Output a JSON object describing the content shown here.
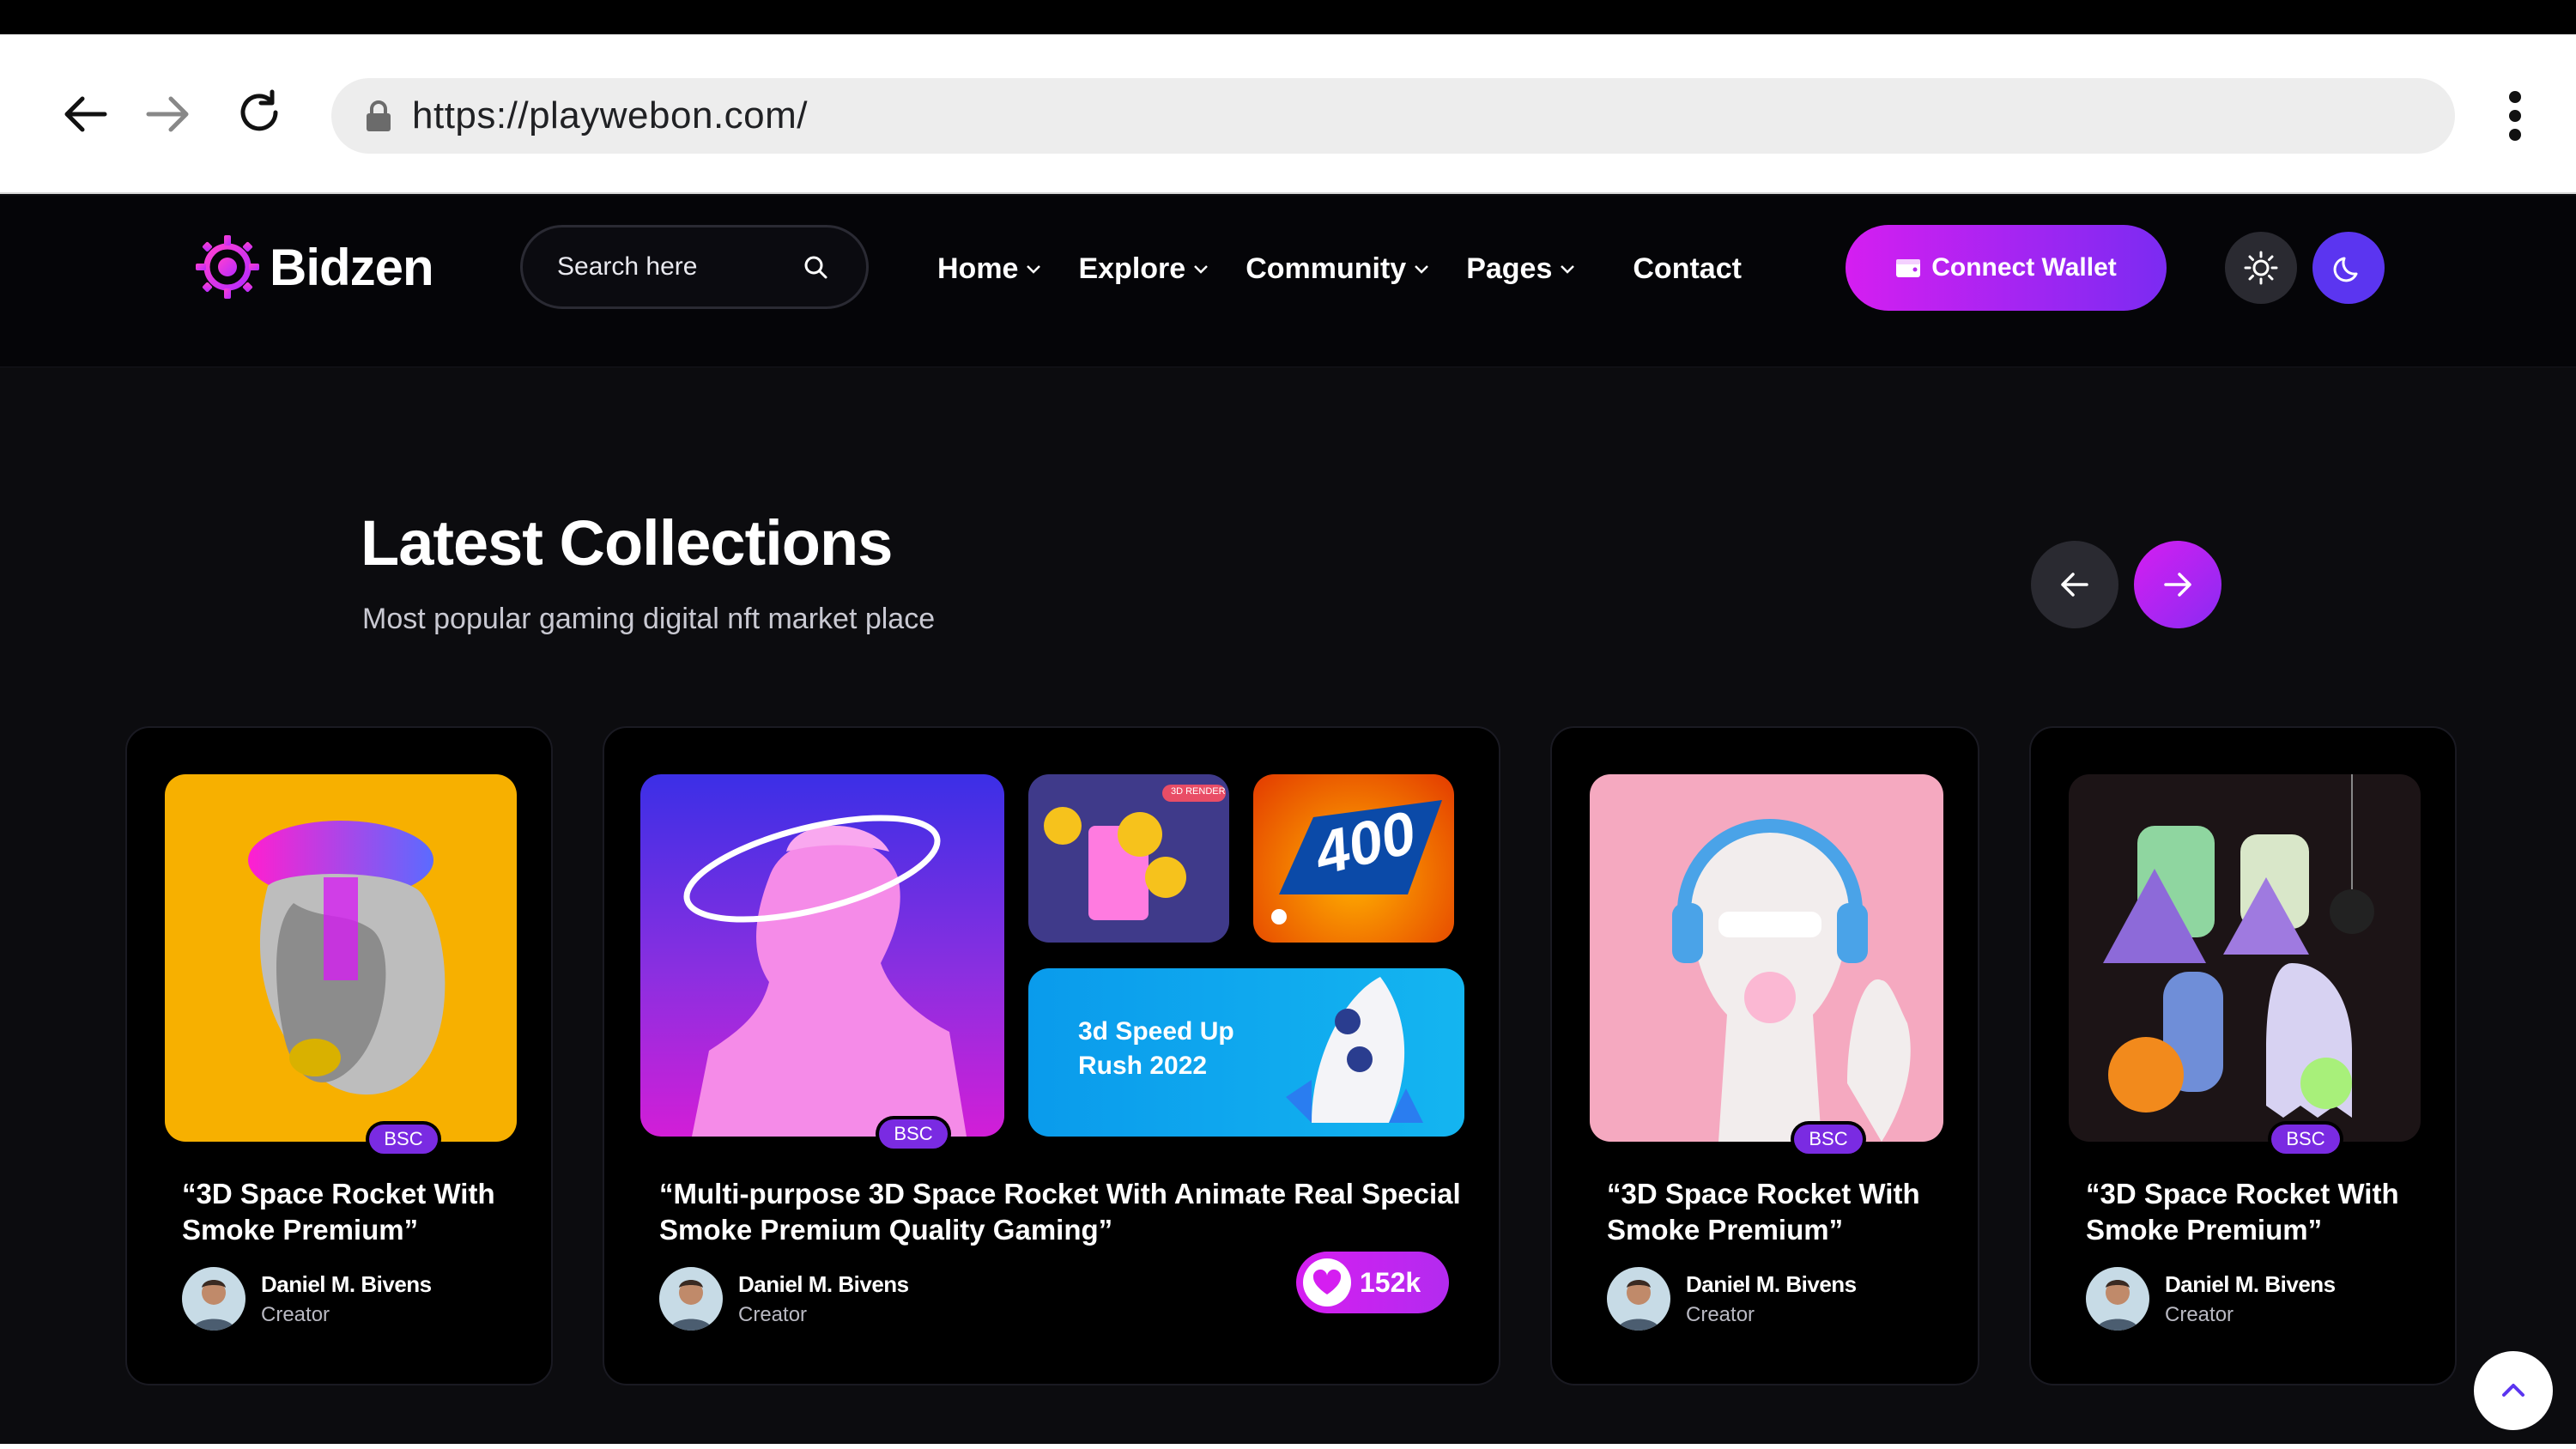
{
  "browser": {
    "url": "https://playwebon.com/"
  },
  "site": {
    "logo_text": "Bidzen",
    "search_placeholder": "Search here",
    "nav": [
      {
        "label": "Home",
        "has_dropdown": true
      },
      {
        "label": "Explore",
        "has_dropdown": true
      },
      {
        "label": "Community",
        "has_dropdown": true
      },
      {
        "label": "Pages",
        "has_dropdown": true
      },
      {
        "label": "Contact",
        "has_dropdown": false
      }
    ],
    "wallet_label": "Connect Wallet"
  },
  "section": {
    "title": "Latest Collections",
    "subtitle": "Most popular gaming digital nft market place"
  },
  "cards": [
    {
      "title_line1": "“3D Space Rocket With",
      "title_line2": "Smoke Premium”",
      "badge": "BSC",
      "author": "Daniel M. Bivens",
      "role": "Creator"
    },
    {
      "title_line1": "“Multi-purpose 3D Space Rocket With Animate Real Special",
      "title_line2": "Smoke Premium Quality Gaming”",
      "badge": "BSC",
      "author": "Daniel M. Bivens",
      "role": "Creator",
      "likes": "152k",
      "banner_line1": "3d Speed Up",
      "banner_line2": "Rush 2022",
      "speed_text": "400",
      "render_tag": "3D RENDER"
    },
    {
      "title_line1": "“3D Space Rocket With",
      "title_line2": "Smoke Premium”",
      "badge": "BSC",
      "author": "Daniel M. Bivens",
      "role": "Creator"
    },
    {
      "title_line1": "“3D Space Rocket With",
      "title_line2": "Smoke Premium”",
      "badge": "BSC",
      "author": "Daniel M. Bivens",
      "role": "Creator"
    }
  ],
  "colors": {
    "accent_pink": "#d51ef1",
    "accent_purple": "#7b2bf2",
    "badge": "#7a2be2",
    "background": "#0c0c0f"
  },
  "icons": [
    "back-arrow-icon",
    "forward-arrow-icon",
    "reload-icon",
    "lock-icon",
    "more-vert-icon",
    "search-icon",
    "chevron-down-icon",
    "wallet-icon",
    "sun-icon",
    "moon-icon",
    "arrow-left-icon",
    "arrow-right-icon",
    "heart-icon",
    "chevron-up-icon"
  ]
}
